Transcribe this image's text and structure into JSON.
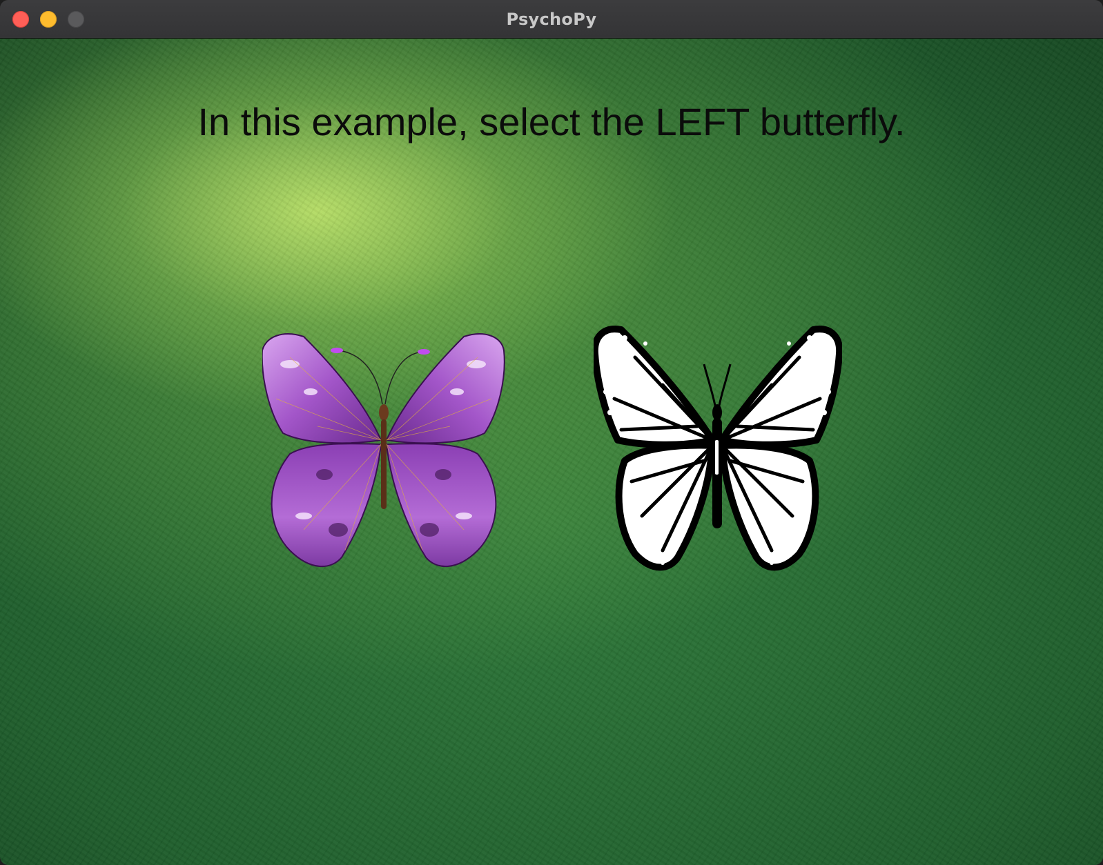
{
  "window": {
    "title": "PsychoPy"
  },
  "stage": {
    "instruction": "In this example, select the LEFT butterfly."
  },
  "stimuli": [
    {
      "name": "purple butterfly",
      "icon": "butterfly-purple-icon"
    },
    {
      "name": "black-and-white butterfly",
      "icon": "butterfly-monarch-outline-icon"
    }
  ],
  "colors": {
    "background": "#2f7a3a",
    "highlight": "#c8eb6e",
    "text": "#0b0b0b",
    "butterfly_purple": "#a056c8",
    "butterfly_outline": "#000000"
  }
}
